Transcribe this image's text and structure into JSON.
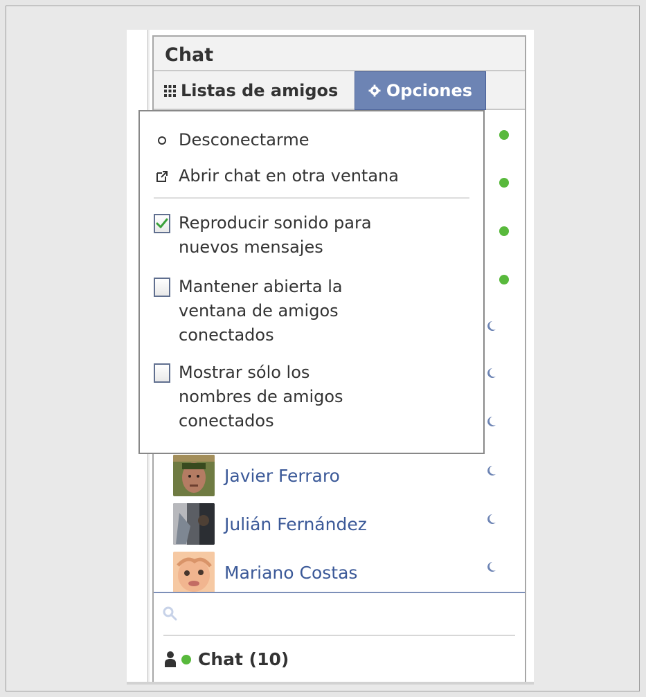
{
  "chat": {
    "title": "Chat",
    "tabs": {
      "friends_lists": "Listas de amigos",
      "options": "Opciones"
    }
  },
  "menu": {
    "items": [
      {
        "label": "Desconectarme",
        "icon": "circle-icon"
      },
      {
        "label": "Abrir chat en otra ventana",
        "icon": "popout-icon"
      }
    ],
    "checkboxes": [
      {
        "label": "Reproducir sonido para\nnuevos mensajes",
        "checked": true
      },
      {
        "label": "Mantener abierta la\nventana de amigos\nconectados",
        "checked": false
      },
      {
        "label": "Mostrar sólo los\nnombres de amigos\nconectados",
        "checked": false
      }
    ]
  },
  "status_indicators": [
    "online",
    "online",
    "online",
    "online",
    "idle",
    "idle",
    "idle",
    "idle",
    "idle",
    "idle"
  ],
  "friends": [
    {
      "name": "Javier Ferraro"
    },
    {
      "name": "Julián Fernández"
    },
    {
      "name": "Mariano Costas"
    }
  ],
  "search": {
    "placeholder": ""
  },
  "footer": {
    "label": "Chat (10)"
  },
  "colors": {
    "accent": "#6d84b4",
    "online": "#58b93c",
    "idle": "#6d84b4",
    "link": "#3b5998"
  }
}
